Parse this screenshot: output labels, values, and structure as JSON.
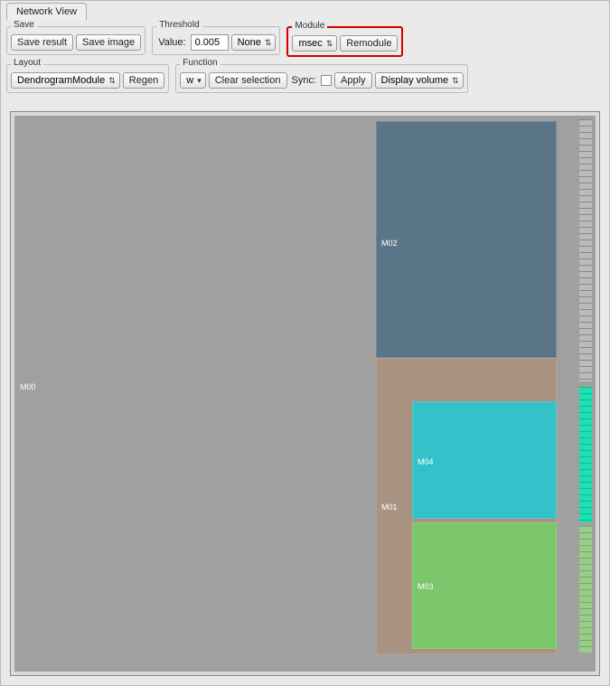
{
  "app": {
    "tab_label": "Network View"
  },
  "save": {
    "group_label": "Save",
    "result_btn": "Save result",
    "image_btn": "Save image"
  },
  "threshold": {
    "group_label": "Threshold",
    "value_label": "Value:",
    "value_input": "0.005",
    "mode_select": "None"
  },
  "module": {
    "group_label": "Module",
    "unit_select": "msec",
    "remodule_btn": "Remodule"
  },
  "layout": {
    "group_label": "Layout",
    "algo_select": "DendrogramModule",
    "regen_btn": "Regen"
  },
  "function": {
    "group_label": "Function",
    "mode_select": "w",
    "clear_btn": "Clear selection",
    "sync_label": "Sync:",
    "sync_checked": false,
    "apply_btn": "Apply",
    "display_select": "Display volume"
  },
  "treemap": {
    "nodes": [
      {
        "id": "M00",
        "color": "#a0a0a0"
      },
      {
        "id": "M02",
        "color": "#5a7587"
      },
      {
        "id": "M01",
        "color": "#aa9280"
      },
      {
        "id": "M04",
        "color": "#34c2ca"
      },
      {
        "id": "M03",
        "color": "#7bc66b"
      }
    ]
  }
}
